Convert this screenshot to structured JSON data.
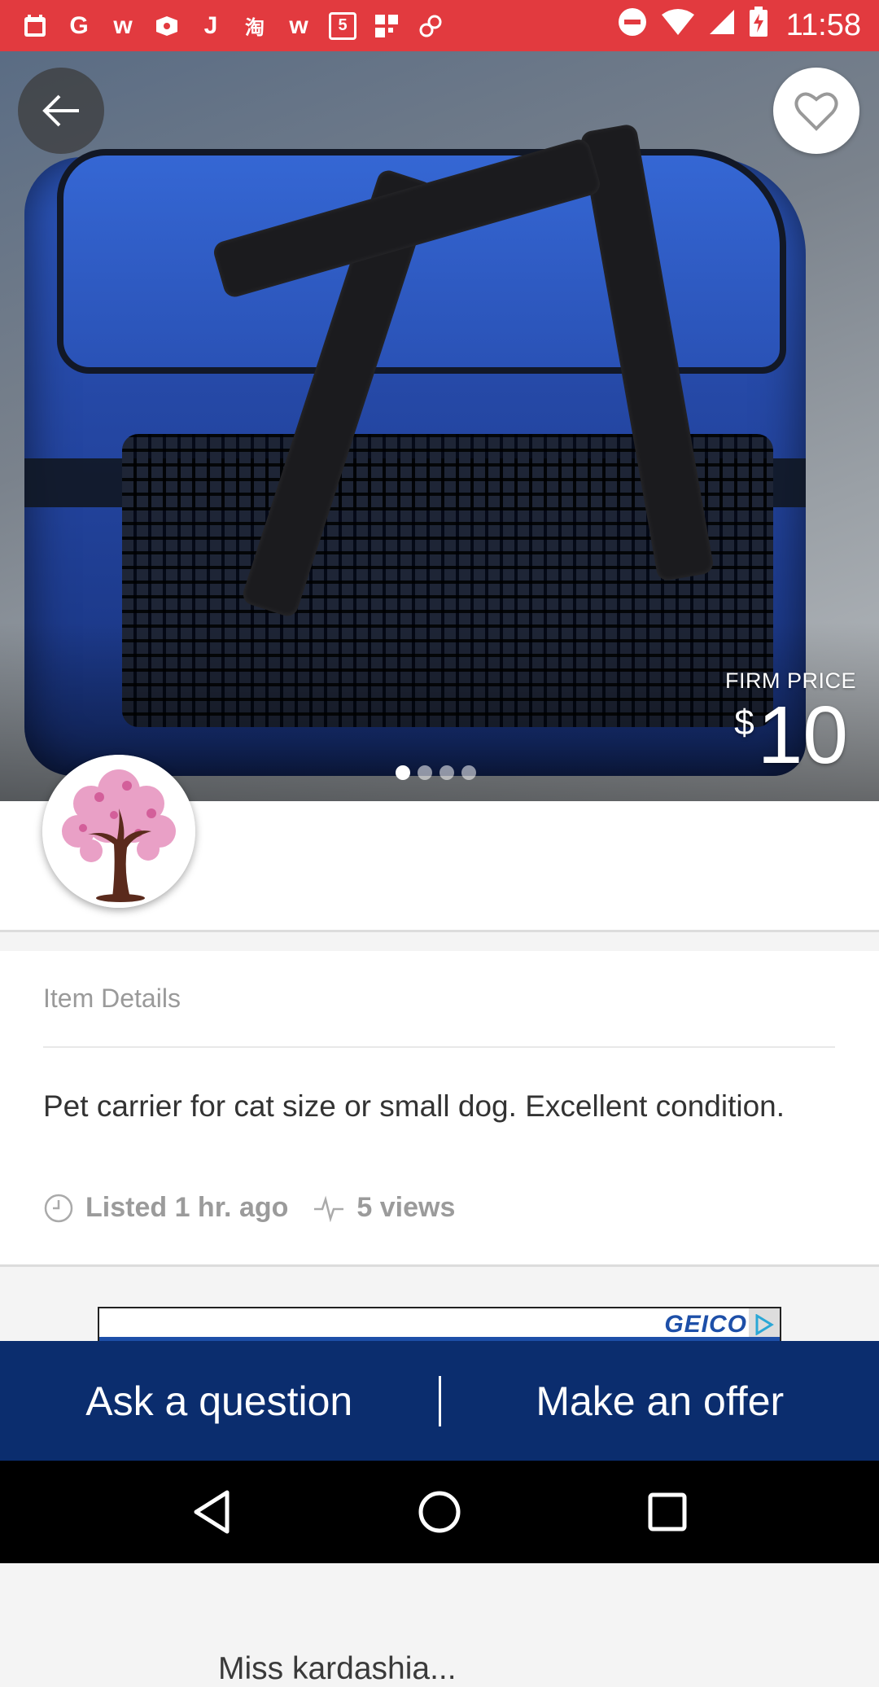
{
  "status_bar": {
    "time": "11:58",
    "notification_icons": [
      "calendar-icon",
      "google-icon",
      "w-app-icon",
      "ticket-icon",
      "j-app-icon",
      "taobao-icon",
      "w-app-icon",
      "five-app-icon",
      "grid-app-icon",
      "link-app-icon"
    ],
    "system_icons": [
      "do-not-disturb-icon",
      "wifi-icon",
      "signal-icon",
      "battery-icon"
    ],
    "background_color": "#e23a3f"
  },
  "listing": {
    "price_label": "FIRM PRICE",
    "price_currency": "$",
    "price_amount": "10",
    "image_count": 4,
    "active_image_index": 1
  },
  "seller": {
    "name": "Miss kardashia..."
  },
  "details": {
    "section_title": "Item Details",
    "description": "Pet carrier for cat size or small dog. Excellent condition.",
    "listed": "Listed 1 hr. ago",
    "views": "5 views"
  },
  "ad": {
    "brand": "GEICO"
  },
  "actions": {
    "ask_label": "Ask a question",
    "offer_label": "Make an offer",
    "background_color": "#0b2d6e"
  },
  "nav": {
    "buttons": [
      "back-triangle-icon",
      "home-circle-icon",
      "recents-square-icon"
    ]
  }
}
